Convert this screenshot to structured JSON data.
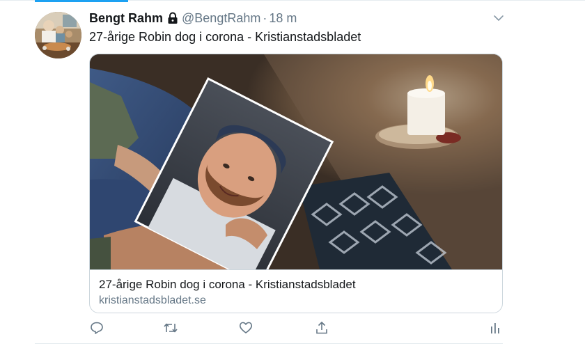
{
  "tweet": {
    "author": {
      "name": "Bengt Rahm",
      "handle": "@BengtRahm",
      "protected_icon": "lock-icon",
      "avatar_icon": "avatar"
    },
    "separator": "·",
    "timestamp": "18 m",
    "text": "27-årige Robin dog i corona - Kristianstadsbladet",
    "card": {
      "title": "27-årige Robin dog i corona - Kristianstadsbladet",
      "domain": "kristianstadsbladet.se"
    },
    "actions": [
      {
        "icon": "reply-icon"
      },
      {
        "icon": "retweet-icon"
      },
      {
        "icon": "like-icon"
      },
      {
        "icon": "share-icon"
      },
      {
        "icon": "analytics-icon"
      }
    ],
    "menu_icon": "chevron-down-icon"
  },
  "colors": {
    "accent": "#1da1f2",
    "text": "#14171a",
    "secondary": "#657786",
    "border": "#ccd6dd"
  }
}
